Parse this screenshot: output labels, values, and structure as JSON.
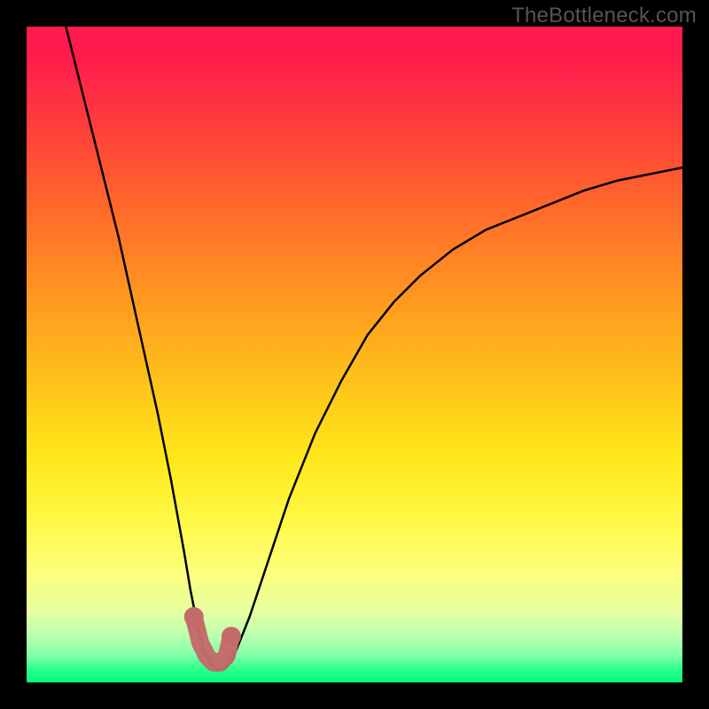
{
  "watermark": "TheBottleneck.com",
  "colors": {
    "background": "#000000",
    "curve": "#000000",
    "marker": "#c46a6a",
    "gradient_top": "#ff1a4d",
    "gradient_bottom": "#00ff7a"
  },
  "chart_data": {
    "type": "line",
    "title": "",
    "xlabel": "",
    "ylabel": "",
    "xlim": [
      0,
      100
    ],
    "ylim": [
      0,
      100
    ],
    "grid": false,
    "legend": false,
    "annotations": [],
    "series": [
      {
        "name": "bottleneck-curve",
        "x": [
          6,
          8,
          10,
          12,
          14,
          16,
          18,
          20,
          22,
          24,
          25,
          26,
          27,
          28,
          29,
          30,
          31,
          32,
          34,
          36,
          38,
          40,
          44,
          48,
          52,
          56,
          60,
          65,
          70,
          75,
          80,
          85,
          90,
          95,
          100
        ],
        "y": [
          100,
          92,
          84,
          76,
          68,
          59,
          50,
          41,
          31,
          20,
          14,
          9,
          5,
          3,
          2,
          2,
          3,
          5,
          10,
          16,
          22,
          28,
          38,
          46,
          53,
          58,
          62,
          66,
          69,
          71,
          73,
          75,
          76.5,
          77.5,
          78.5
        ]
      }
    ],
    "highlight": {
      "name": "optimal-range-marker",
      "x": [
        25.5,
        26.5,
        27.5,
        28.5,
        29.5,
        30.5,
        31.2
      ],
      "y": [
        10,
        6,
        4,
        3,
        3,
        4,
        7
      ]
    }
  }
}
